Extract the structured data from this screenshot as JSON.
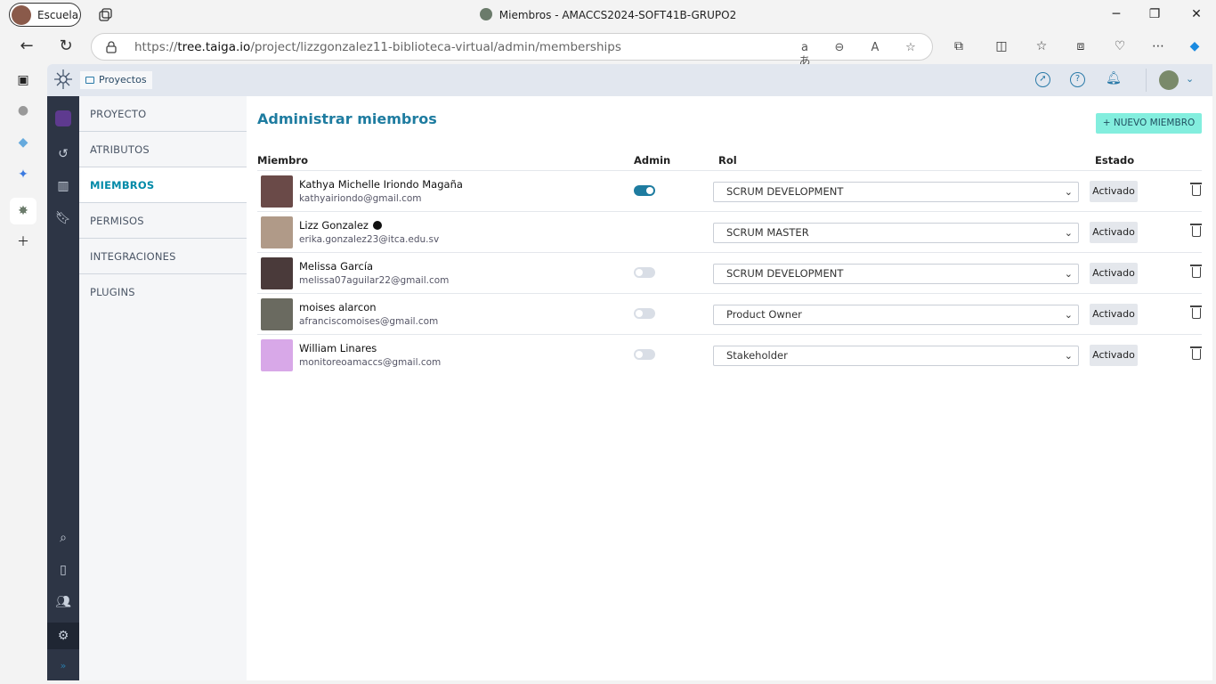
{
  "browser": {
    "profile_label": "Escuela",
    "window_title": "Miembros - AMACCS2024-SOFT41B-GRUPO2",
    "url_prefix": "https://",
    "url_host": "tree.taiga.io",
    "url_path": "/project/lizzgonzalez11-biblioteca-virtual/admin/memberships"
  },
  "app": {
    "breadcrumb": "Proyectos"
  },
  "submenu": {
    "items": [
      "PROYECTO",
      "ATRIBUTOS",
      "MIEMBROS",
      "PERMISOS",
      "INTEGRACIONES",
      "PLUGINS"
    ],
    "selected": "MIEMBROS"
  },
  "page": {
    "title": "Administrar miembros",
    "new_member_button": "+ NUEVO MIEMBRO",
    "columns": {
      "member": "Miembro",
      "admin": "Admin",
      "role": "Rol",
      "status": "Estado"
    }
  },
  "members": [
    {
      "name": "Kathya Michelle Iriondo Magaña",
      "email": "kathyairiondo@gmail.com",
      "admin": true,
      "role": "SCRUM DEVELOPMENT",
      "status": "Activado",
      "owner": false,
      "avatar_color": "#6a4a48"
    },
    {
      "name": "Lizz Gonzalez",
      "email": "erika.gonzalez23@itca.edu.sv",
      "admin": null,
      "role": "SCRUM MASTER",
      "status": "Activado",
      "owner": true,
      "avatar_color": "#b09a88"
    },
    {
      "name": "Melissa García",
      "email": "melissa07aguilar22@gmail.com",
      "admin": false,
      "role": "SCRUM DEVELOPMENT",
      "status": "Activado",
      "owner": false,
      "avatar_color": "#4a3a3a"
    },
    {
      "name": "moises alarcon",
      "email": "afranciscomoises@gmail.com",
      "admin": false,
      "role": "Product Owner",
      "status": "Activado",
      "owner": false,
      "avatar_color": "#6a6a60"
    },
    {
      "name": "William Linares",
      "email": "monitoreoamaccs@gmail.com",
      "admin": false,
      "role": "Stakeholder",
      "status": "Activado",
      "owner": false,
      "avatar_color": "#d8a8e8"
    }
  ],
  "colors": {
    "accent": "#1e7ca0",
    "new_button": "#83eede",
    "rail": "#2d3545"
  }
}
